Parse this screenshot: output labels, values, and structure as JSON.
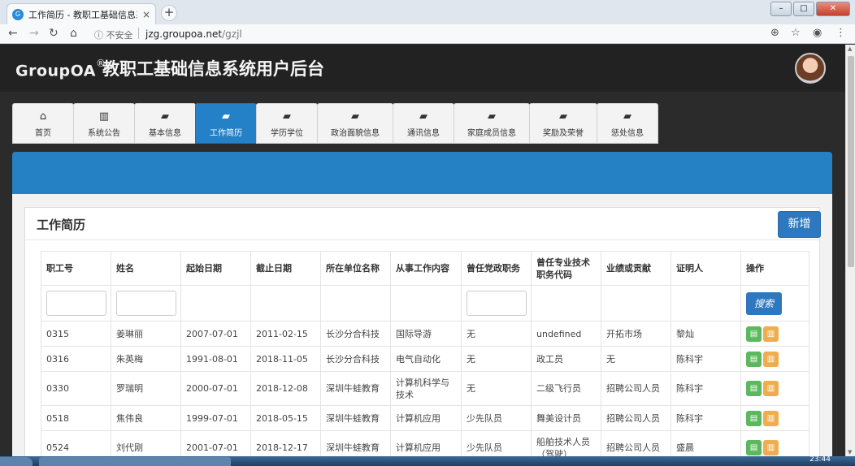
{
  "browser": {
    "tab_title": "工作简历 - 教职工基础信息系统",
    "tab_favicon": "G",
    "tab_close": "×",
    "newtab": "+",
    "security": "不安全",
    "url_host": "jzg.groupoa.net",
    "url_path": "/gzjl",
    "win_minimize": "–",
    "win_maximize": "□",
    "win_close": "✕"
  },
  "header": {
    "brand": "GroupOA",
    "brand_mark": "®",
    "title": "教职工基础信息系统用户后台"
  },
  "nav": {
    "tabs": [
      {
        "label": "首页",
        "icon": "home-icon",
        "glyph": "⌂"
      },
      {
        "label": "系统公告",
        "icon": "chart-icon",
        "glyph": "▥"
      },
      {
        "label": "基本信息",
        "icon": "book-icon",
        "glyph": "▰"
      },
      {
        "label": "工作简历",
        "icon": "book-icon",
        "glyph": "▰",
        "active": true
      },
      {
        "label": "学历学位",
        "icon": "book-icon",
        "glyph": "▰"
      },
      {
        "label": "政治面貌信息",
        "icon": "book-icon",
        "glyph": "▰"
      },
      {
        "label": "通讯信息",
        "icon": "book-icon",
        "glyph": "▰"
      },
      {
        "label": "家庭成员信息",
        "icon": "book-icon",
        "glyph": "▰"
      },
      {
        "label": "奖励及荣誉",
        "icon": "book-icon",
        "glyph": "▰"
      },
      {
        "label": "惩处信息",
        "icon": "book-icon",
        "glyph": "▰"
      }
    ]
  },
  "panel": {
    "title": "工作简历",
    "add_label": "新增",
    "search_label": "搜索"
  },
  "table": {
    "columns": [
      "职工号",
      "姓名",
      "起始日期",
      "截止日期",
      "所在单位名称",
      "从事工作内容",
      "曾任党政职务",
      "曾任专业技术职务代码",
      "业绩或贡献",
      "证明人",
      "操作"
    ],
    "rows": [
      [
        "0315",
        "姜琳丽",
        "2007-07-01",
        "2011-02-15",
        "长沙分合科技",
        "国际导游",
        "无",
        "undefined",
        "开拓市场",
        "黎灿"
      ],
      [
        "0316",
        "朱英梅",
        "1991-08-01",
        "2018-11-05",
        "长沙分合科技",
        "电气自动化",
        "无",
        "政工员",
        "无",
        "陈科宇"
      ],
      [
        "0330",
        "罗瑞明",
        "2000-07-01",
        "2018-12-08",
        "深圳牛蛙教育",
        "计算机科学与技术",
        "无",
        "二级飞行员",
        "招聘公司人员",
        "陈科宇"
      ],
      [
        "0518",
        "焦伟良",
        "1999-07-01",
        "2018-05-15",
        "深圳牛蛙教育",
        "计算机应用",
        "少先队员",
        "舞美设计员",
        "招聘公司人员",
        "陈科宇"
      ],
      [
        "0524",
        "刘代刚",
        "2001-07-01",
        "2018-12-17",
        "深圳牛蛙教育",
        "计算机应用",
        "少先队员",
        "船舶技术人员（驾驶）",
        "招聘公司人员",
        "盛晨"
      ]
    ]
  },
  "taskbar": {
    "clock": "23:44"
  }
}
